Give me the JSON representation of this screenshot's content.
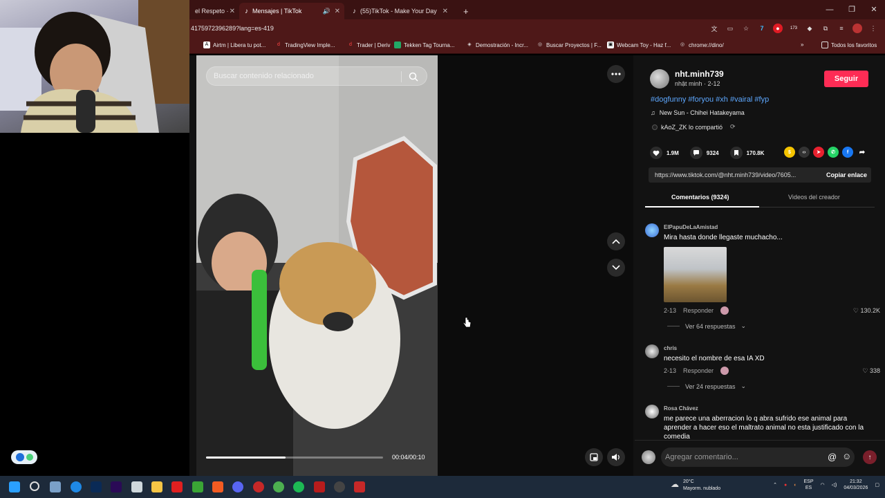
{
  "browser": {
    "tabs": [
      {
        "title": "el Respeto ·"
      },
      {
        "title": "Mensajes | TikTok",
        "active": true
      },
      {
        "title": "(55)TikTok - Make Your Day"
      }
    ],
    "url": "4175972396289?lang=es-419",
    "bookmarks": [
      "Airtm | Libera tu pot...",
      "TradingView Imple...",
      "Trader | Deriv",
      "Tekken Tag Tourna...",
      "Demostración - Incr...",
      "Buscar Proyectos | F...",
      "Webcam Toy - Haz f...",
      "chrome://dino/",
      "Todos los favoritos"
    ],
    "extension_badge": "173"
  },
  "video": {
    "search_placeholder": "Buscar contenido relacionado",
    "time": "00:04/00:10",
    "progress": 0.45
  },
  "post": {
    "username": "nht.minh739",
    "subtitle": "nhật minh · 2-12",
    "follow_label": "Seguir",
    "hashtags": "#dogfunny #foryou #xh #vairal #fyp",
    "music": "New Sun - Chihei Hatakeyama",
    "shared_by": "kAoZ_ZK lo compartió",
    "likes": "1.9M",
    "comments_count": "9324",
    "saves": "170.8K",
    "link": "https://www.tiktok.com/@nht.minh739/video/7605...",
    "copy_label": "Copiar enlace",
    "tab_comments": "Comentarios (9324)",
    "tab_creator": "Videos del creador"
  },
  "comments": [
    {
      "name": "ElPapuDeLaAmistad",
      "text": "Mira hasta donde llegaste muchacho...",
      "date": "2-13",
      "reply": "Responder",
      "likes": "130.2K",
      "replies": "Ver 64 respuestas"
    },
    {
      "name": "chris",
      "text": "necesito el nombre de esa IA XD",
      "date": "2-13",
      "reply": "Responder",
      "likes": "338",
      "replies": "Ver 24 respuestas"
    },
    {
      "name": "Rosa Chávez",
      "text": "me parece una aberracion lo q abra sufrido ese animal para aprender a hacer eso el maltrato animal no esta justificado con la comedia"
    }
  ],
  "comment_input_placeholder": "Agregar comentario...",
  "taskbar": {
    "weather_temp": "20°C",
    "weather_desc": "Mayorm. nublado",
    "lang": "ESP",
    "lang2": "ES",
    "time": "21:32",
    "date": "04/03/2026"
  },
  "colors": {
    "accent": "#fe2c55",
    "hashtag": "#5ea8ff",
    "chrome": "#4e1818"
  }
}
